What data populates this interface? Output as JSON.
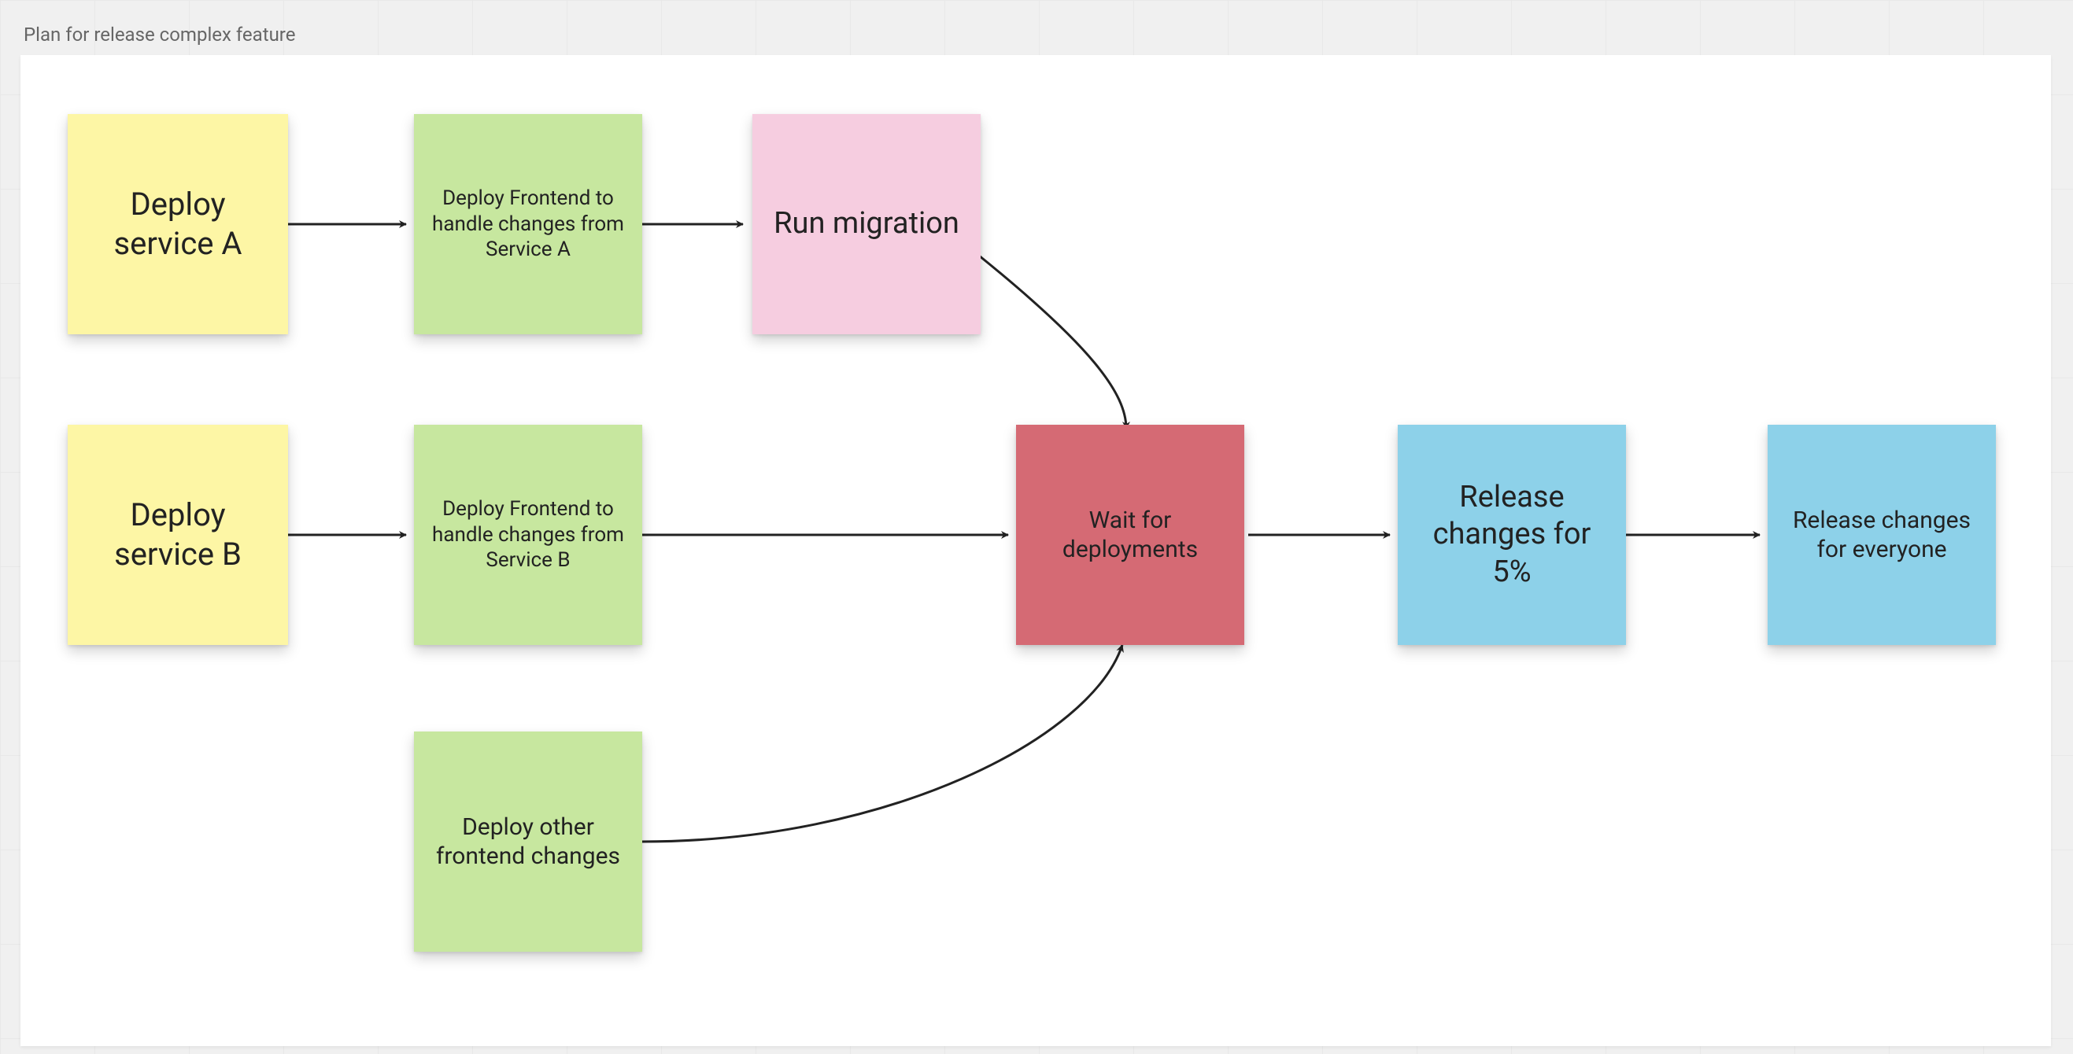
{
  "frame": {
    "title": "Plan for release complex feature"
  },
  "notes": {
    "deploy_a": "Deploy service A",
    "deploy_b": "Deploy service B",
    "frontend_a": "Deploy Frontend to handle changes from Service A",
    "frontend_b": "Deploy Frontend to handle changes from Service B",
    "other_frontend": "Deploy other frontend changes",
    "migration": "Run migration",
    "wait": "Wait for deployments",
    "release_5": "Release changes for 5%",
    "release_all": "Release changes for everyone"
  },
  "colors": {
    "yellow": "#fdf6a5",
    "green": "#c7e79f",
    "pink": "#f6cde0",
    "red": "#d56a74",
    "blue": "#8dd1e9"
  }
}
